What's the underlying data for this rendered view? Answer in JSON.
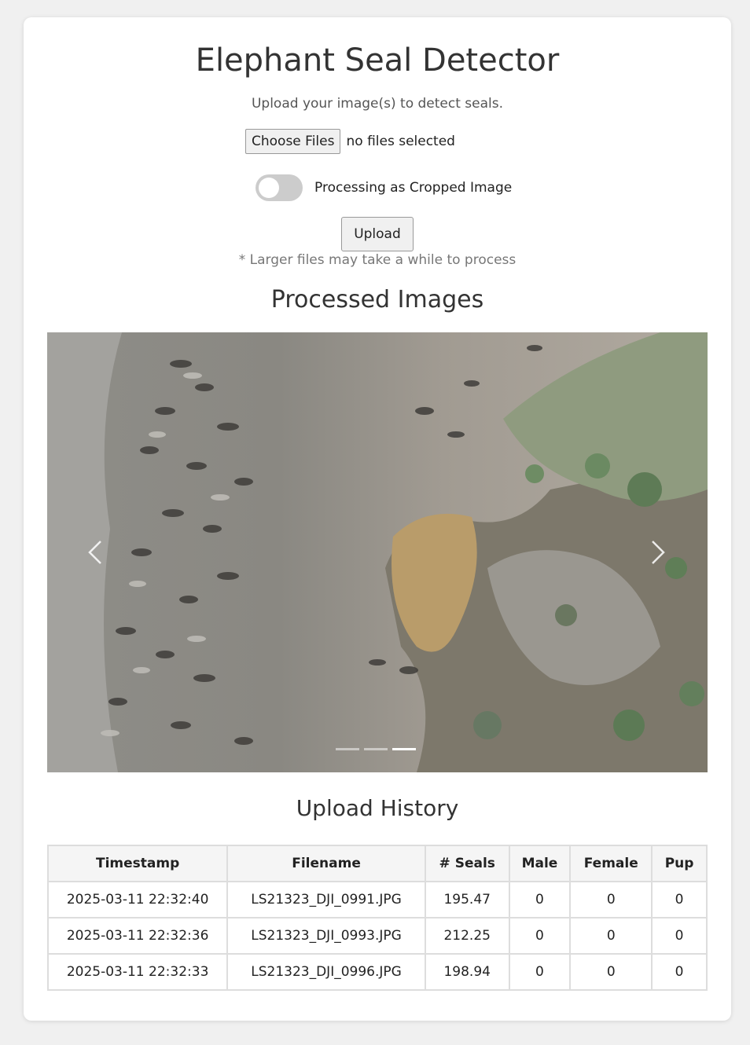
{
  "header": {
    "title": "Elephant Seal Detector",
    "subtitle": "Upload your image(s) to detect seals."
  },
  "upload_form": {
    "choose_files_label": "Choose Files",
    "file_status": "no files selected",
    "toggle_label": "Processing as Cropped Image",
    "toggle_on": false,
    "upload_label": "Upload",
    "note": "* Larger files may take a while to process"
  },
  "gallery": {
    "heading": "Processed Images",
    "slide_count": 3,
    "active_slide": 3
  },
  "history": {
    "heading": "Upload History",
    "columns": [
      "Timestamp",
      "Filename",
      "# Seals",
      "Male",
      "Female",
      "Pup"
    ],
    "rows": [
      [
        "2025-03-11 22:32:40",
        "LS21323_DJI_0991.JPG",
        "195.47",
        "0",
        "0",
        "0"
      ],
      [
        "2025-03-11 22:32:36",
        "LS21323_DJI_0993.JPG",
        "212.25",
        "0",
        "0",
        "0"
      ],
      [
        "2025-03-11 22:32:33",
        "LS21323_DJI_0996.JPG",
        "198.94",
        "0",
        "0",
        "0"
      ]
    ]
  },
  "icons": {
    "prev": "chevron-left-icon",
    "next": "chevron-right-icon"
  },
  "colors": {
    "page_background": "#f0f0f0",
    "card_background": "#ffffff",
    "toggle_off": "#cccccc",
    "table_border": "#dddddd",
    "table_header_background": "#f5f5f5"
  }
}
